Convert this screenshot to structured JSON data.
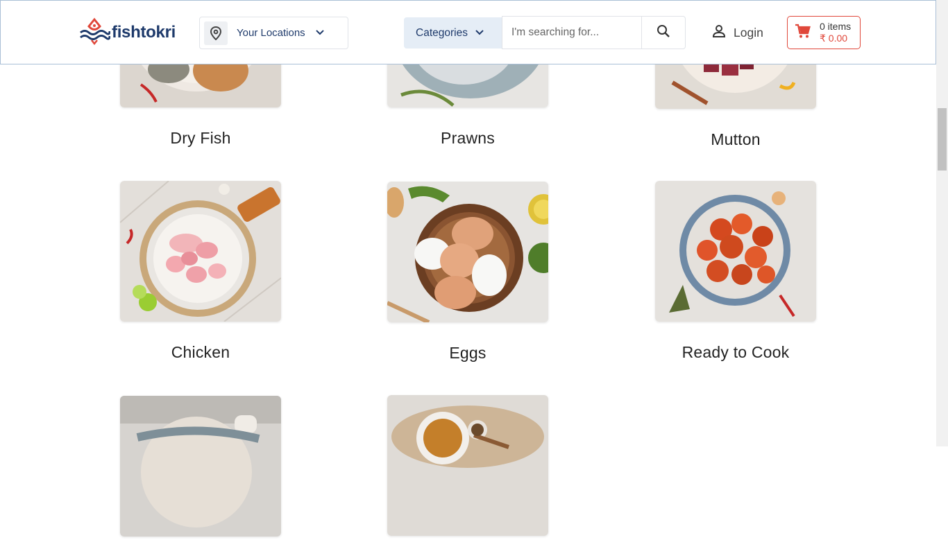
{
  "header": {
    "logo_text": "fishtokri",
    "location_label": "Your Locations",
    "categories_label": "Categories",
    "search_placeholder": "I'm searching for...",
    "login_label": "Login",
    "cart": {
      "items": "0 items",
      "total": "₹ 0.00"
    }
  },
  "colors": {
    "brand_navy": "#1e3a6b",
    "accent_red": "#e0473a",
    "category_bg": "#e5edf6"
  },
  "icons": [
    "fish-logo-icon",
    "location-pin-icon",
    "chevron-down-icon",
    "search-icon",
    "user-icon",
    "cart-icon"
  ],
  "categories": [
    {
      "name": "Dry Fish"
    },
    {
      "name": "Prawns"
    },
    {
      "name": "Mutton"
    },
    {
      "name": "Chicken"
    },
    {
      "name": "Eggs"
    },
    {
      "name": "Ready to Cook"
    },
    {
      "name": ""
    },
    {
      "name": ""
    }
  ]
}
